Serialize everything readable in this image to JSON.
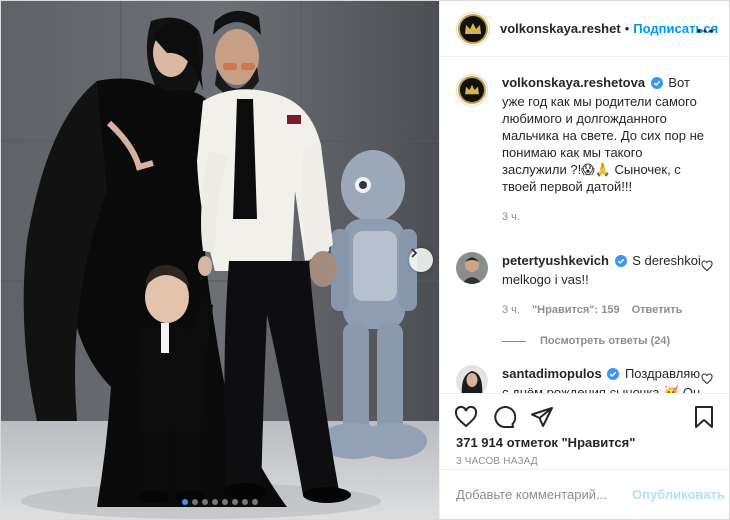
{
  "header": {
    "username": "volkonskaya.reshet",
    "separator": "•",
    "follow_label": "Подписаться",
    "more_icon": "more-horizontal-icon"
  },
  "caption": {
    "username": "volkonskaya.reshetova",
    "text": "Вот уже год как мы родители самого любимого и долгожданного мальчика на свете. До сих пор не понимаю как мы такого заслужили ?!😱🙏 Сыночек, с твоей первой датой!!!",
    "time": "3 ч."
  },
  "comments": [
    {
      "username": "petertyushkevich",
      "text": "S dereshkoi melkogo i vas!!",
      "time": "3 ч.",
      "likes": "\"Нравится\": 159",
      "reply_label": "Ответить",
      "view_replies": "Посмотреть ответы (24)"
    },
    {
      "username": "santadimopulos",
      "text": "Поздравляю с днём рождения сыночка 🥳 Он у вас просто нереальный"
    }
  ],
  "actions": {
    "likes_text": "371 914 отметок \"Нравится\"",
    "time_ago": "3 ЧАСОВ НАЗАД",
    "comment_placeholder": "Добавьте комментарий...",
    "publish_label": "Опубликовать"
  },
  "carousel": {
    "total_slides": 8,
    "active_index": 0
  },
  "colors": {
    "accent": "#0095f6",
    "verified": "#3897f0",
    "publish_disabled": "#b2dffc"
  }
}
